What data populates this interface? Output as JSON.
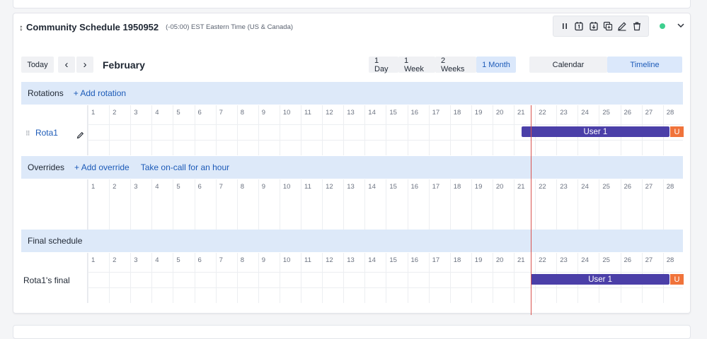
{
  "schedule": {
    "title": "Community Schedule 1950952",
    "timezone": "(-05:00) EST Eastern Time (US & Canada)",
    "status_color": "#3ecf8e"
  },
  "toolbar": {
    "today": "Today",
    "prev": "‹",
    "next": "›",
    "month": "February",
    "ranges": [
      "1 Day",
      "1 Week",
      "2 Weeks",
      "1 Month"
    ],
    "active_range": "1 Month",
    "views": [
      "Calendar",
      "Timeline"
    ],
    "active_view": "Timeline"
  },
  "days": [
    "1",
    "2",
    "3",
    "4",
    "5",
    "6",
    "7",
    "8",
    "9",
    "10",
    "11",
    "12",
    "13",
    "14",
    "15",
    "16",
    "17",
    "18",
    "19",
    "20",
    "21",
    "22",
    "23",
    "24",
    "25",
    "26",
    "27",
    "28"
  ],
  "rotations": {
    "title": "Rotations",
    "add_label": "+ Add rotation",
    "rows": [
      {
        "name": "Rota1",
        "shifts": [
          {
            "user": "User 1",
            "start_day": 21.35
          },
          {
            "user": "U",
            "start_day": 28.35
          }
        ]
      }
    ]
  },
  "overrides": {
    "title": "Overrides",
    "add_label": "+ Add override",
    "take_oncall_label": "Take on-call for an hour"
  },
  "final": {
    "title": "Final schedule",
    "rows": [
      {
        "name": "Rota1's final",
        "shifts": [
          {
            "user": "User 1",
            "start_day": 21.8
          },
          {
            "user": "U",
            "start_day": 28.35
          }
        ]
      }
    ]
  },
  "now_day": 21.8
}
